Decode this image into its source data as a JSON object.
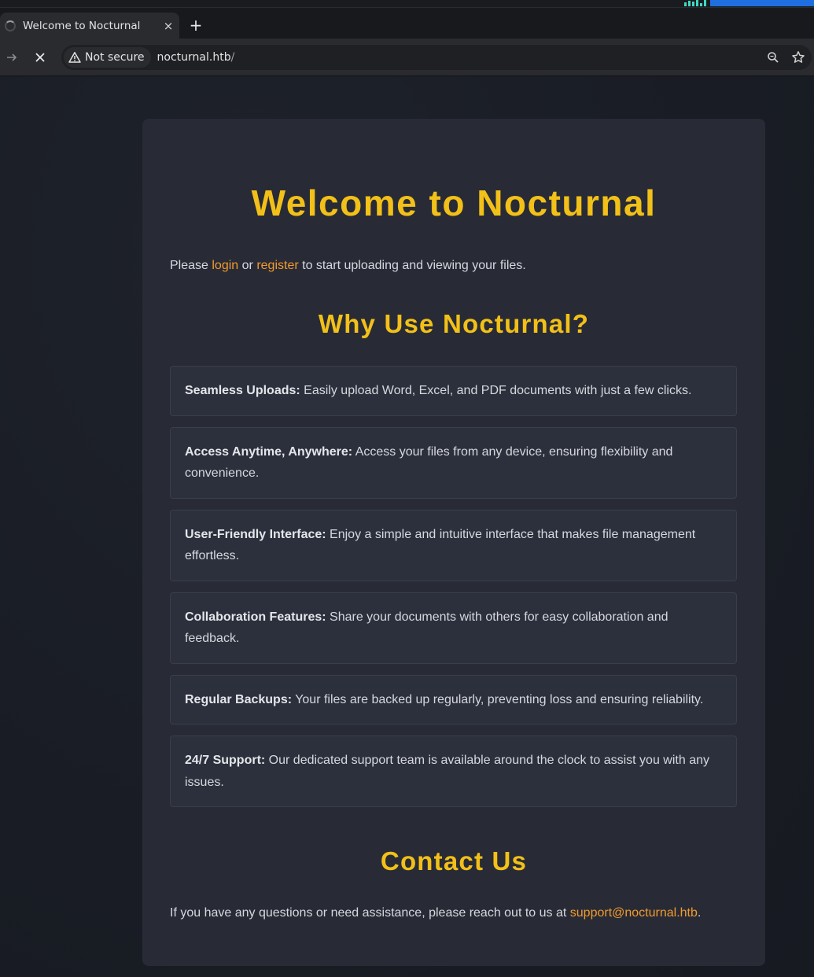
{
  "browser": {
    "tab_title": "Welcome to Nocturnal",
    "tab_close": "×",
    "new_tab": "+",
    "security_label": "Not secure",
    "url_host": "nocturnal.htb",
    "url_path": "/"
  },
  "page": {
    "title": "Welcome to Nocturnal",
    "intro": {
      "before": "Please ",
      "login": "login",
      "or": " or ",
      "register": "register",
      "after": " to start uploading and viewing your files."
    },
    "why_title": "Why Use Nocturnal?",
    "features": [
      {
        "title": "Seamless Uploads:",
        "text": " Easily upload Word, Excel, and PDF documents with just a few clicks."
      },
      {
        "title": "Access Anytime, Anywhere:",
        "text": " Access your files from any device, ensuring flexibility and convenience."
      },
      {
        "title": "User-Friendly Interface:",
        "text": " Enjoy a simple and intuitive interface that makes file management effortless."
      },
      {
        "title": "Collaboration Features:",
        "text": " Share your documents with others for easy collaboration and feedback."
      },
      {
        "title": "Regular Backups:",
        "text": " Your files are backed up regularly, preventing loss and ensuring reliability."
      },
      {
        "title": "24/7 Support:",
        "text": " Our dedicated support team is available around the clock to assist you with any issues."
      }
    ],
    "contact_title": "Contact Us",
    "contact": {
      "before": "If you have any questions or need assistance, please reach out to us at ",
      "email": "support@nocturnal.htb",
      "after": "."
    }
  },
  "colors": {
    "accent_heading": "#f2c018",
    "link": "#f29a2e",
    "card_bg": "#282b36",
    "page_bg": "#1b1e26"
  }
}
